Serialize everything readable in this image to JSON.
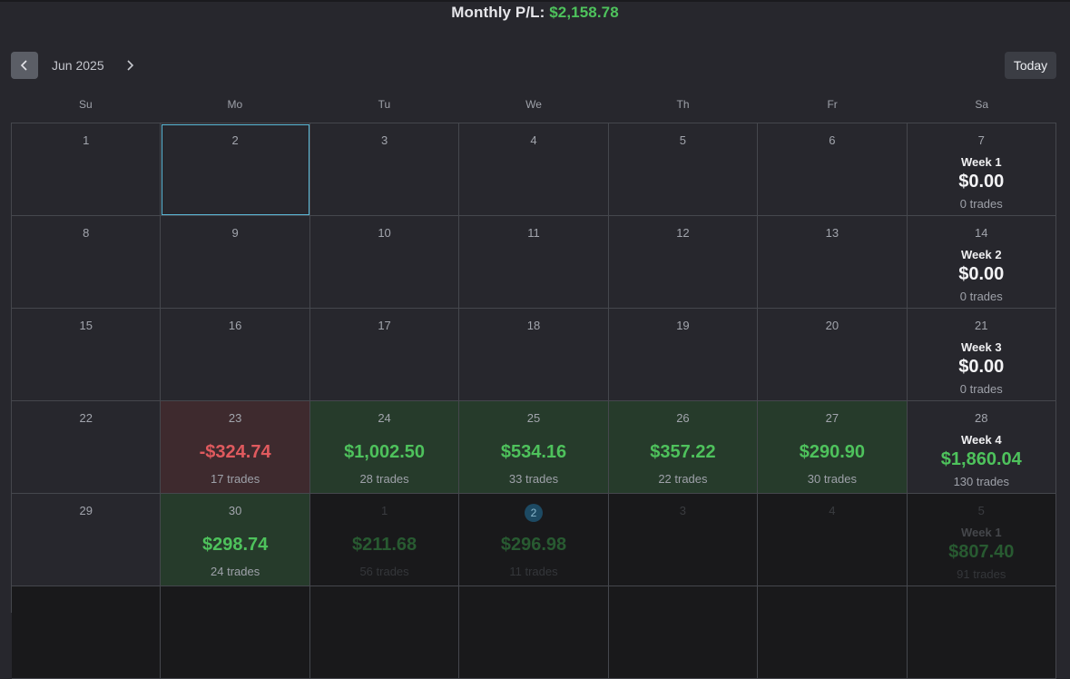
{
  "header": {
    "label": "Monthly P/L:",
    "value": "$2,158.78"
  },
  "nav": {
    "month": "Jun 2025",
    "today_label": "Today"
  },
  "weekdays": [
    "Su",
    "Mo",
    "Tu",
    "We",
    "Th",
    "Fr",
    "Sa"
  ],
  "colors": {
    "accent": "#4ec25c",
    "loss": "#e05a5e",
    "selected_border": "#5ab8d6"
  },
  "icons": {
    "prev": "chevron-left-icon",
    "next": "chevron-right-icon"
  },
  "rows": [
    {
      "days": [
        {
          "d": "1"
        },
        {
          "d": "2",
          "selected": true
        },
        {
          "d": "3"
        },
        {
          "d": "4"
        },
        {
          "d": "5"
        },
        {
          "d": "6"
        },
        {
          "d": "7",
          "week": "Week 1",
          "week_pnl": "$0.00",
          "week_trades": "0 trades"
        }
      ]
    },
    {
      "days": [
        {
          "d": "8"
        },
        {
          "d": "9"
        },
        {
          "d": "10"
        },
        {
          "d": "11"
        },
        {
          "d": "12"
        },
        {
          "d": "13"
        },
        {
          "d": "14",
          "week": "Week 2",
          "week_pnl": "$0.00",
          "week_trades": "0 trades"
        }
      ]
    },
    {
      "days": [
        {
          "d": "15"
        },
        {
          "d": "16"
        },
        {
          "d": "17"
        },
        {
          "d": "18"
        },
        {
          "d": "19"
        },
        {
          "d": "20"
        },
        {
          "d": "21",
          "week": "Week 3",
          "week_pnl": "$0.00",
          "week_trades": "0 trades"
        }
      ]
    },
    {
      "days": [
        {
          "d": "22"
        },
        {
          "d": "23",
          "pnl": "-$324.74",
          "trades": "17 trades",
          "kind": "loss"
        },
        {
          "d": "24",
          "pnl": "$1,002.50",
          "trades": "28 trades",
          "kind": "win"
        },
        {
          "d": "25",
          "pnl": "$534.16",
          "trades": "33 trades",
          "kind": "win"
        },
        {
          "d": "26",
          "pnl": "$357.22",
          "trades": "22 trades",
          "kind": "win"
        },
        {
          "d": "27",
          "pnl": "$290.90",
          "trades": "30 trades",
          "kind": "win"
        },
        {
          "d": "28",
          "week": "Week 4",
          "week_pnl": "$1,860.04",
          "week_trades": "130 trades",
          "week_kind": "pos"
        }
      ]
    },
    {
      "days": [
        {
          "d": "29"
        },
        {
          "d": "30",
          "pnl": "$298.74",
          "trades": "24 trades",
          "kind": "win"
        },
        {
          "d": "1",
          "pnl": "$211.68",
          "trades": "56 trades",
          "kind": "win",
          "other": true
        },
        {
          "d": "2",
          "pnl": "$296.98",
          "trades": "11 trades",
          "kind": "win",
          "other": true,
          "today": true
        },
        {
          "d": "3",
          "other": true
        },
        {
          "d": "4",
          "other": true
        },
        {
          "d": "5",
          "week": "Week 1",
          "week_pnl": "$807.40",
          "week_trades": "91 trades",
          "week_kind": "pos",
          "other": true
        }
      ]
    },
    {
      "days": [
        {
          "d": "",
          "other": true
        },
        {
          "d": "",
          "other": true
        },
        {
          "d": "",
          "other": true
        },
        {
          "d": "",
          "other": true
        },
        {
          "d": "",
          "other": true
        },
        {
          "d": "",
          "other": true
        },
        {
          "d": "",
          "other": true
        }
      ]
    }
  ]
}
